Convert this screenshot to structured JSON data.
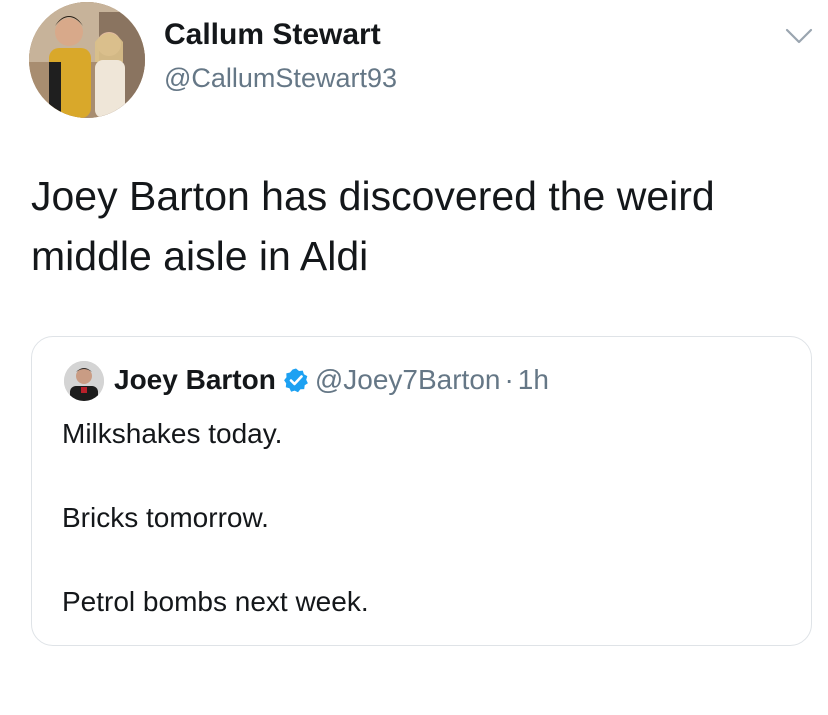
{
  "author": {
    "name": "Callum Stewart",
    "handle": "@CallumStewart93",
    "avatar_icon": "profile-photo-two-people"
  },
  "menu_icon": "chevron-down-icon",
  "tweet": {
    "text": "Joey Barton has discovered the weird middle aisle in Aldi"
  },
  "quoted_tweet": {
    "author_name": "Joey Barton",
    "verified_icon": "verified-badge-icon",
    "handle": "@Joey7Barton",
    "separator": "·",
    "time": "1h",
    "lines": [
      "Milkshakes today.",
      "Bricks tomorrow.",
      "Petrol bombs next week."
    ]
  },
  "colors": {
    "text": "#14171a",
    "secondary": "#657786",
    "verified": "#1da1f2",
    "card_border": "#dfe3e7"
  }
}
